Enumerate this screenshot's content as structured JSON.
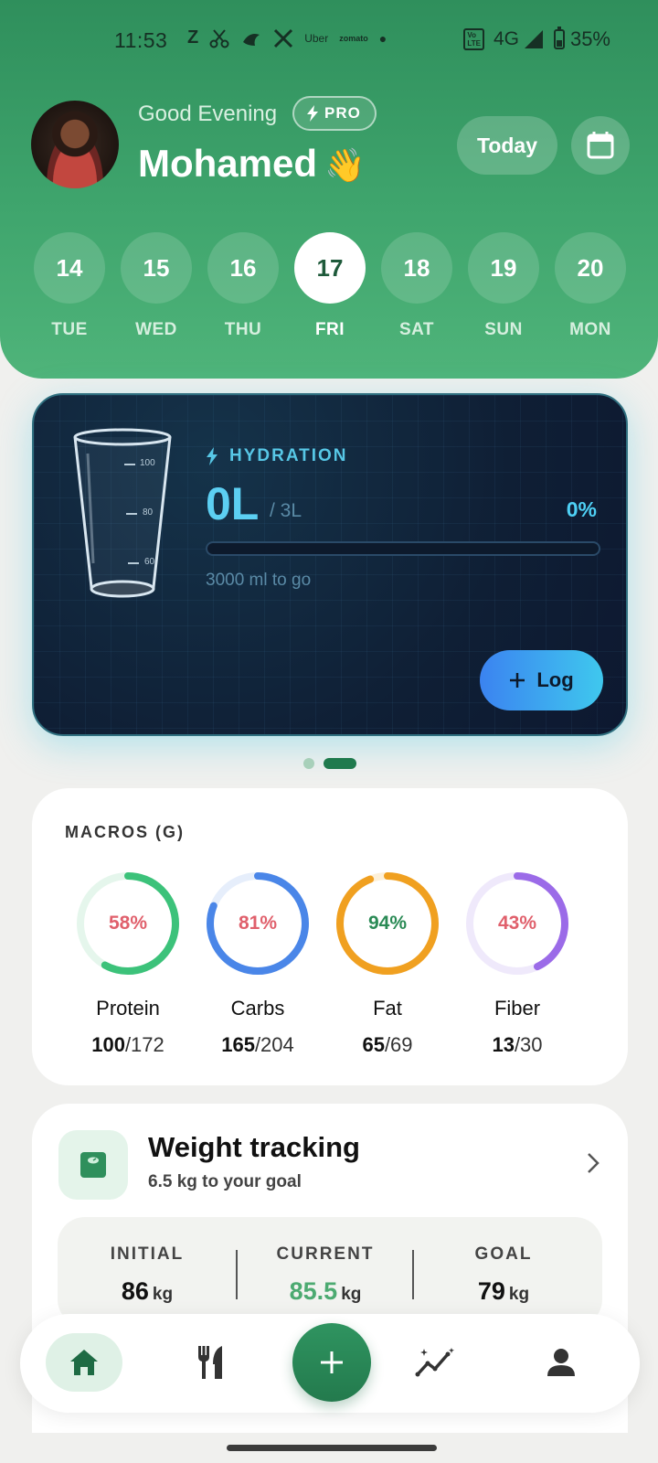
{
  "status_bar": {
    "time": "11:53",
    "apps": [
      "Z",
      "Uber",
      "zomato"
    ],
    "network": "4G",
    "battery": "35%"
  },
  "header": {
    "greeting": "Good Evening",
    "badge": "PRO",
    "user_name": "Mohamed",
    "emoji": "👋",
    "today_label": "Today",
    "accent_color": "#3fa56d"
  },
  "days": [
    {
      "num": "14",
      "name": "TUE"
    },
    {
      "num": "15",
      "name": "WED"
    },
    {
      "num": "16",
      "name": "THU"
    },
    {
      "num": "17",
      "name": "FRI"
    },
    {
      "num": "18",
      "name": "SAT"
    },
    {
      "num": "19",
      "name": "SUN"
    },
    {
      "num": "20",
      "name": "MON"
    }
  ],
  "selected_day": "17",
  "hydration": {
    "label": "HYDRATION",
    "value": "0L",
    "goal": "/ 3L",
    "percent": "0%",
    "progress": 0,
    "remaining": "3000 ml to go",
    "log_label": "Log",
    "glass_marks": [
      "100",
      "80",
      "60"
    ]
  },
  "carousel": {
    "pages": 2,
    "active": 2
  },
  "macros": {
    "title": "MACROS (G)",
    "items": [
      {
        "name": "Protein",
        "percent": "58%",
        "progress": 0.58,
        "current": "100",
        "target": "/172",
        "color": "#3cc27a",
        "track": "#e5f6ec",
        "pct_color": "#e0606c"
      },
      {
        "name": "Carbs",
        "percent": "81%",
        "progress": 0.81,
        "current": "165",
        "target": "/204",
        "color": "#4a86e8",
        "track": "#e6eefb",
        "pct_color": "#e0606c"
      },
      {
        "name": "Fat",
        "percent": "94%",
        "progress": 0.94,
        "current": "65",
        "target": "/69",
        "color": "#f0a020",
        "track": "#fdf0d8",
        "pct_color": "#2a8a55"
      },
      {
        "name": "Fiber",
        "percent": "43%",
        "progress": 0.43,
        "current": "13",
        "target": "/30",
        "color": "#9b6be8",
        "track": "#efe9fb",
        "pct_color": "#e0606c"
      }
    ]
  },
  "weight": {
    "title": "Weight tracking",
    "subtitle": "6.5 kg to your goal",
    "initial": {
      "label": "INITIAL",
      "value": "86",
      "unit": "kg"
    },
    "current": {
      "label": "CURRENT",
      "value": "85.5",
      "unit": "kg"
    },
    "goal": {
      "label": "GOAL",
      "value": "79",
      "unit": "kg"
    }
  },
  "nav": {
    "items": [
      "home-icon",
      "utensils-icon",
      "add-icon",
      "trends-icon",
      "profile-icon"
    ],
    "active": "home-icon"
  }
}
